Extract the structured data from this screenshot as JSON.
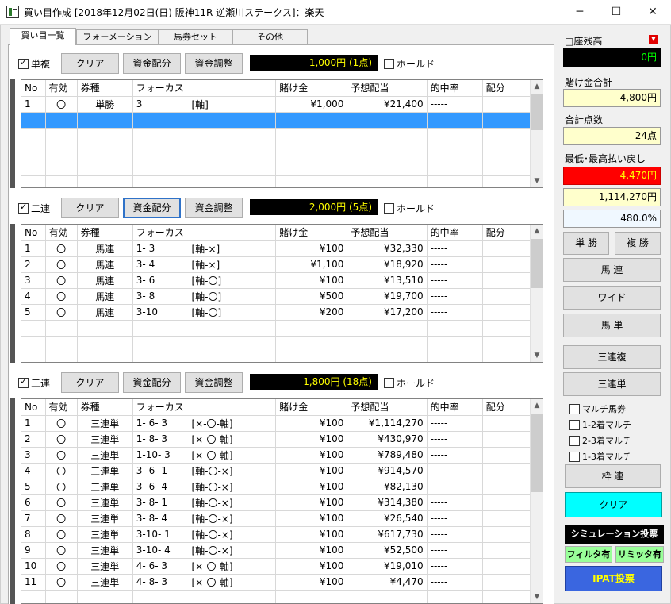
{
  "window": {
    "title": "買い目作成 [2018年12月02日(日) 阪神11R 逆瀬川ステークス]：楽天",
    "minimize": "─",
    "maximize": "☐",
    "close": "✕"
  },
  "tabs": [
    {
      "label": "買い目一覧"
    },
    {
      "label": "フォーメーション"
    },
    {
      "label": "馬券セット"
    },
    {
      "label": "その他"
    }
  ],
  "columns": [
    "No",
    "有効",
    "券種",
    "フォーカス",
    "賭け金",
    "予想配当",
    "的中率",
    "配分"
  ],
  "sections": [
    {
      "name": "単複",
      "checked": true,
      "clear": "クリア",
      "alloc": "資金配分",
      "adjust": "資金調整",
      "total": "1,000円 (1点)",
      "hold": "ホールド",
      "rows": [
        [
          "1",
          "〇",
          "単勝",
          "3",
          "[軸]",
          "¥1,000",
          "¥21,400",
          "-----",
          ""
        ]
      ]
    },
    {
      "name": "二連",
      "checked": true,
      "clear": "クリア",
      "alloc": "資金配分",
      "adjust": "資金調整",
      "total": "2,000円 (5点)",
      "hold": "ホールド",
      "rows": [
        [
          "1",
          "〇",
          "馬連",
          "1- 3",
          "[軸-×]",
          "¥100",
          "¥32,330",
          "-----",
          ""
        ],
        [
          "2",
          "〇",
          "馬連",
          "3- 4",
          "[軸-×]",
          "¥1,100",
          "¥18,920",
          "-----",
          ""
        ],
        [
          "3",
          "〇",
          "馬連",
          "3- 6",
          "[軸-〇]",
          "¥100",
          "¥13,510",
          "-----",
          ""
        ],
        [
          "4",
          "〇",
          "馬連",
          "3- 8",
          "[軸-〇]",
          "¥500",
          "¥19,700",
          "-----",
          ""
        ],
        [
          "5",
          "〇",
          "馬連",
          "3-10",
          "[軸-〇]",
          "¥200",
          "¥17,200",
          "-----",
          ""
        ]
      ]
    },
    {
      "name": "三連",
      "checked": true,
      "clear": "クリア",
      "alloc": "資金配分",
      "adjust": "資金調整",
      "total": "1,800円 (18点)",
      "hold": "ホールド",
      "rows": [
        [
          "1",
          "〇",
          "三連単",
          "1- 6- 3",
          "[×-〇-軸]",
          "¥100",
          "¥1,114,270",
          "-----",
          ""
        ],
        [
          "2",
          "〇",
          "三連単",
          "1- 8- 3",
          "[×-〇-軸]",
          "¥100",
          "¥430,970",
          "-----",
          ""
        ],
        [
          "3",
          "〇",
          "三連単",
          "1-10- 3",
          "[×-〇-軸]",
          "¥100",
          "¥789,480",
          "-----",
          ""
        ],
        [
          "4",
          "〇",
          "三連単",
          "3- 6- 1",
          "[軸-〇-×]",
          "¥100",
          "¥914,570",
          "-----",
          ""
        ],
        [
          "5",
          "〇",
          "三連単",
          "3- 6- 4",
          "[軸-〇-×]",
          "¥100",
          "¥82,130",
          "-----",
          ""
        ],
        [
          "6",
          "〇",
          "三連単",
          "3- 8- 1",
          "[軸-〇-×]",
          "¥100",
          "¥314,380",
          "-----",
          ""
        ],
        [
          "7",
          "〇",
          "三連単",
          "3- 8- 4",
          "[軸-〇-×]",
          "¥100",
          "¥26,540",
          "-----",
          ""
        ],
        [
          "8",
          "〇",
          "三連単",
          "3-10- 1",
          "[軸-〇-×]",
          "¥100",
          "¥617,730",
          "-----",
          ""
        ],
        [
          "9",
          "〇",
          "三連単",
          "3-10- 4",
          "[軸-〇-×]",
          "¥100",
          "¥52,500",
          "-----",
          ""
        ],
        [
          "10",
          "〇",
          "三連単",
          "4- 6- 3",
          "[×-〇-軸]",
          "¥100",
          "¥19,010",
          "-----",
          ""
        ],
        [
          "11",
          "〇",
          "三連単",
          "4- 8- 3",
          "[×-〇-軸]",
          "¥100",
          "¥4,470",
          "-----",
          ""
        ]
      ]
    }
  ],
  "side": {
    "balance_label": "□座残高",
    "balance": "0円",
    "bet_total_label": "賭け金合計",
    "bet_total": "4,800円",
    "points_label": "合計点数",
    "points": "24点",
    "payout_label": "最低･最高払い戻し",
    "payout_min": "4,470円",
    "payout_max": "1,114,270円",
    "ratio": "480.0%",
    "btn_tan": "単 勝",
    "btn_fuku": "複 勝",
    "btn_umaren": "馬 連",
    "btn_wide": "ワイド",
    "btn_umatan": "馬 単",
    "btn_sanrenpuku": "三連複",
    "btn_sanrentan": "三連単",
    "multi": [
      {
        "label": "マルチ馬券"
      },
      {
        "label": "1-2着マルチ"
      },
      {
        "label": "2-3着マルチ"
      },
      {
        "label": "1-3着マルチ"
      }
    ],
    "btn_wakuren": "枠 連",
    "btn_clear": "クリア",
    "btn_sim": "シミュレーション投票",
    "btn_filter": "フィルタ有",
    "btn_limit": "リミッタ有",
    "btn_ipat": "IPAT投票"
  },
  "colors": {
    "accent": "#3399ff",
    "lcd_text": "#ffff00",
    "green_text": "#00ff00",
    "red": "#ff0000",
    "cyan": "#00ffff",
    "ipat": "#3a66e0",
    "filter_green": "#99ff99"
  }
}
